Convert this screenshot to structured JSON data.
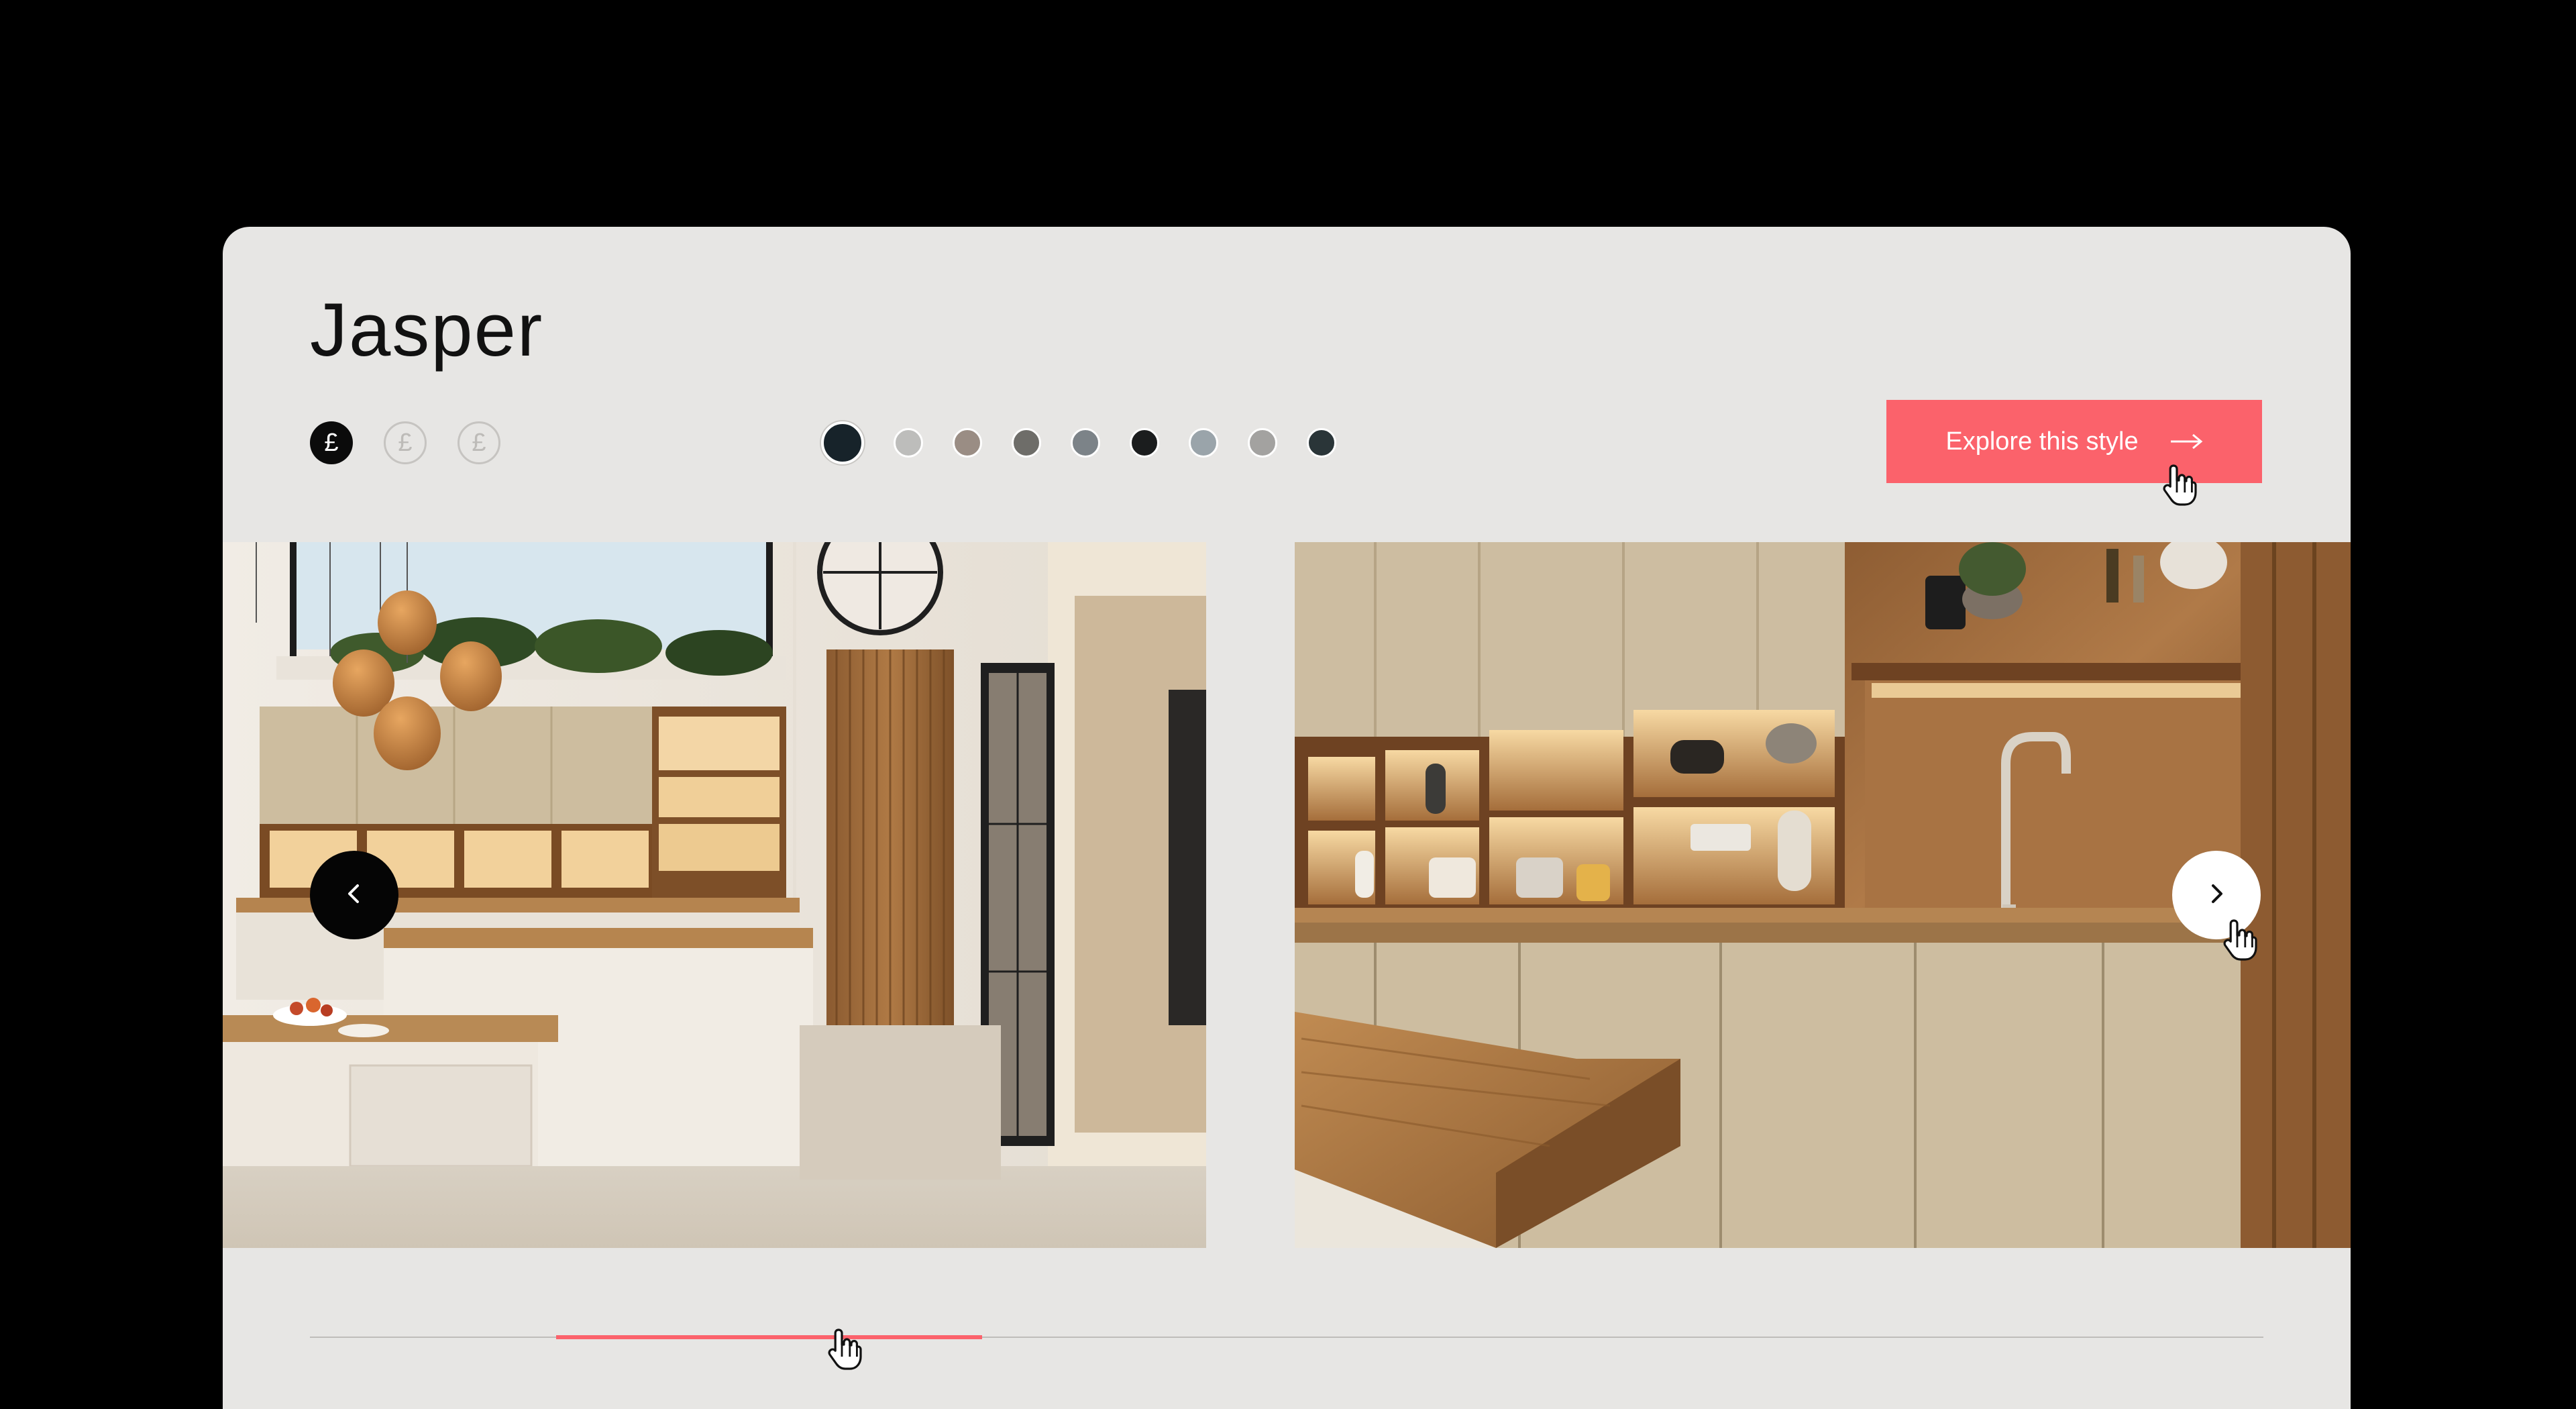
{
  "product": {
    "title": "Jasper"
  },
  "price_levels": [
    {
      "symbol": "£",
      "active": true
    },
    {
      "symbol": "£",
      "active": false
    },
    {
      "symbol": "£",
      "active": false
    }
  ],
  "colour_swatches": [
    {
      "color": "#17232a",
      "selected": true
    },
    {
      "color": "#bdbdbb",
      "selected": false
    },
    {
      "color": "#9a8d84",
      "selected": false
    },
    {
      "color": "#6e6d69",
      "selected": false
    },
    {
      "color": "#7c8388",
      "selected": false
    },
    {
      "color": "#1b1d1e",
      "selected": false
    },
    {
      "color": "#9aa4aa",
      "selected": false
    },
    {
      "color": "#a3a2a0",
      "selected": false
    },
    {
      "color": "#2a3538",
      "selected": false
    }
  ],
  "cta": {
    "label": "Explore this style",
    "icon": "arrow-right-icon"
  },
  "carousel": {
    "slides": [
      {
        "name": "kitchen-island-room"
      },
      {
        "name": "kitchen-shelving-closeup"
      }
    ],
    "prev_icon": "chevron-left-icon",
    "next_icon": "chevron-right-icon",
    "progress": {
      "start": 0.126,
      "end": 0.344
    }
  },
  "colors": {
    "accent": "#fb626b",
    "panel": "#e7e6e4",
    "background": "#000000"
  }
}
